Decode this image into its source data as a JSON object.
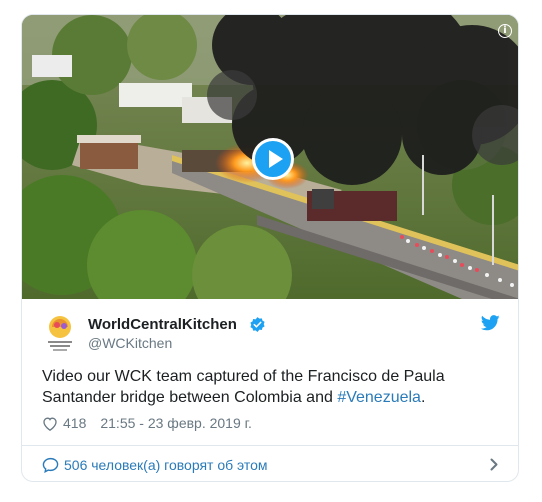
{
  "author": {
    "name": "WorldCentralKitchen",
    "handle": "@WCKitchen",
    "avatar_caption": "WORLD CENTRAL KITCHEN"
  },
  "tweet": {
    "text_before": "Video our WCK team captured of the Francisco de Paula Santander bridge between Colombia and ",
    "hashtag": "#Venezuela",
    "text_after": "."
  },
  "meta": {
    "likes": "418",
    "timestamp": "21:55 - 23 февр. 2019 г."
  },
  "footer": {
    "people_talking": "506 человек(а) говорят об этом"
  },
  "icons": {
    "play": "play-icon",
    "info": "info-icon",
    "verified": "verified-badge-icon",
    "brand": "twitter-bird-icon",
    "like": "heart-icon",
    "comment": "speech-bubble-icon",
    "more": "chevron-right-icon"
  },
  "colors": {
    "accent": "#1da1f2",
    "link": "#2b7bb9",
    "secondary_text": "#697882",
    "border": "#e1e8ed"
  }
}
